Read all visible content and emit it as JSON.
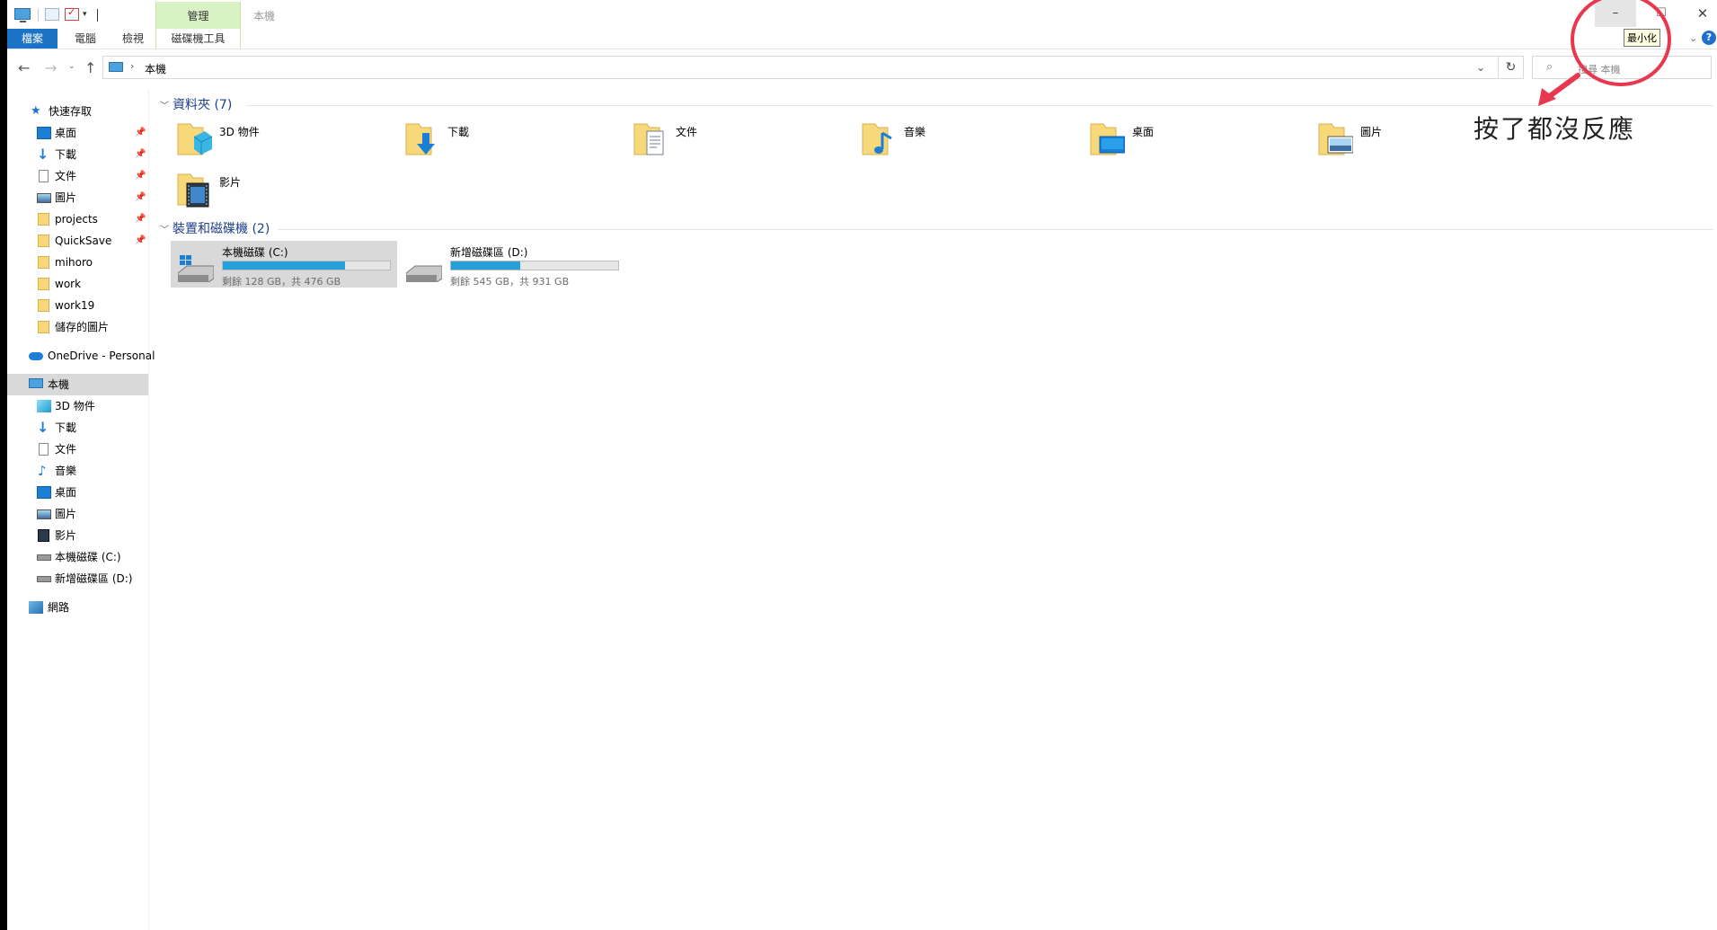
{
  "quick_access": {
    "icons": [
      "this-pc-icon",
      "properties-icon",
      "checkbox-icon",
      "customize-dropdown-icon"
    ]
  },
  "ribbon": {
    "context_group": "管理",
    "tabs": [
      {
        "label": "檔案",
        "active": false
      },
      {
        "label": "電腦"
      },
      {
        "label": "檢視"
      },
      {
        "label": "磁碟機工具"
      }
    ]
  },
  "window": {
    "title": "本機",
    "buttons": {
      "minimize": "–",
      "maximize": "☐",
      "close": "✕"
    },
    "tooltip": "最小化"
  },
  "address": {
    "separator": "›",
    "path": "本機",
    "dropdown": "⌄",
    "refresh": "↻",
    "search_placeholder": "搜尋 本機",
    "nav": {
      "back": "←",
      "forward": "→",
      "recent": "⌄",
      "up": "↑"
    }
  },
  "sidebar": {
    "quick_access_label": "快速存取",
    "pinned": [
      {
        "label": "桌面",
        "icon": "desktop-icon"
      },
      {
        "label": "下載",
        "icon": "downloads-icon"
      },
      {
        "label": "文件",
        "icon": "documents-icon"
      },
      {
        "label": "圖片",
        "icon": "pictures-icon"
      },
      {
        "label": "projects",
        "icon": "folder-icon"
      },
      {
        "label": "QuickSave",
        "icon": "folder-icon"
      }
    ],
    "recent": [
      {
        "label": "mihoro",
        "icon": "folder-icon"
      },
      {
        "label": "work",
        "icon": "folder-icon"
      },
      {
        "label": "work19",
        "icon": "folder-icon"
      },
      {
        "label": "儲存的圖片",
        "icon": "folder-icon"
      }
    ],
    "onedrive_label": "OneDrive - Personal",
    "this_pc_label": "本機",
    "this_pc_items": [
      {
        "label": "3D 物件",
        "icon": "3d-objects-icon"
      },
      {
        "label": "下載",
        "icon": "downloads-icon"
      },
      {
        "label": "文件",
        "icon": "documents-icon"
      },
      {
        "label": "音樂",
        "icon": "music-icon"
      },
      {
        "label": "桌面",
        "icon": "desktop-icon"
      },
      {
        "label": "圖片",
        "icon": "pictures-icon"
      },
      {
        "label": "影片",
        "icon": "videos-icon"
      },
      {
        "label": "本機磁碟 (C:)",
        "icon": "drive-c-icon"
      },
      {
        "label": "新增磁碟區 (D:)",
        "icon": "drive-d-icon"
      }
    ],
    "network_label": "網路"
  },
  "content": {
    "folders_header": "資料夾 (7)",
    "folders": [
      {
        "label": "3D 物件",
        "icon": "3d-objects-folder-icon"
      },
      {
        "label": "下載",
        "icon": "downloads-folder-icon"
      },
      {
        "label": "文件",
        "icon": "documents-folder-icon"
      },
      {
        "label": "音樂",
        "icon": "music-folder-icon"
      },
      {
        "label": "桌面",
        "icon": "desktop-folder-icon"
      },
      {
        "label": "圖片",
        "icon": "pictures-folder-icon"
      },
      {
        "label": "影片",
        "icon": "videos-folder-icon"
      }
    ],
    "drives_header": "裝置和磁碟機 (2)",
    "drives": [
      {
        "name": "本機磁碟 (C:)",
        "space": "剩餘 128 GB，共 476 GB",
        "used_fraction": 0.731,
        "selected": true
      },
      {
        "name": "新增磁碟區 (D:)",
        "space": "剩餘 545 GB，共 931 GB",
        "used_fraction": 0.415,
        "selected": false
      }
    ]
  },
  "colors": {
    "accent": "#1a73c4",
    "context_tab": "#d9f2c4",
    "drive_fill": "#26a0da",
    "annotation": "#e8384f",
    "selection": "#d9d9d9"
  },
  "annotation": {
    "text": "按了都沒反應"
  }
}
